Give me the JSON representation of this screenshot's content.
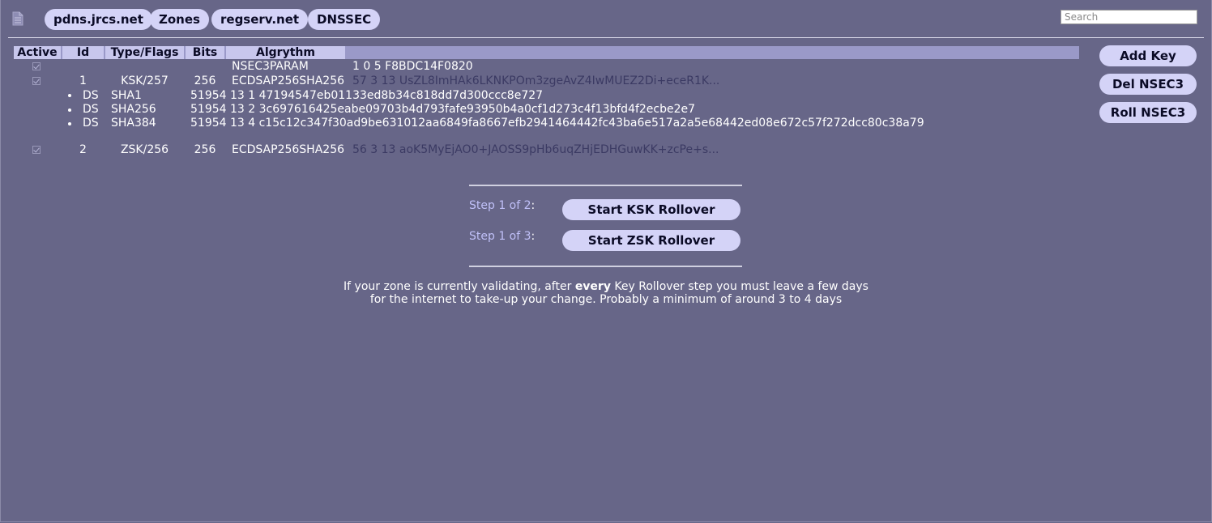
{
  "nav": {
    "items": [
      "pdns.jrcs.net",
      "Zones",
      "regserv.net",
      "DNSSEC"
    ],
    "search_placeholder": "Search"
  },
  "table": {
    "headers": [
      "Active",
      "Id",
      "Type/Flags",
      "Bits",
      "Algrythm"
    ],
    "nsec3param": {
      "label": "NSEC3PARAM",
      "value": "1 0 5 F8BDC14F0820",
      "active": true
    },
    "keys": [
      {
        "active": true,
        "id": "1",
        "type_flags": "KSK/257",
        "bits": "256",
        "algorithm": "ECDSAP256SHA256",
        "key": "57 3 13 UsZL8ImHAk6LKNKPOm3zgeAvZ4IwMUEZ2Di+eceR1K...",
        "ds": [
          {
            "label": "DS",
            "digest_type": "SHA1",
            "value": "51954 13 1 47194547eb01133ed8b34c818dd7d300ccc8e727"
          },
          {
            "label": "DS",
            "digest_type": "SHA256",
            "value": "51954 13 2 3c697616425eabe09703b4d793fafe93950b4a0cf1d273c4f13bfd4f2ecbe2e7"
          },
          {
            "label": "DS",
            "digest_type": "SHA384",
            "value": "51954 13 4 c15c12c347f30ad9be631012aa6849fa8667efb2941464442fc43ba6e517a2a5e68442ed08e672c57f272dcc80c38a79"
          }
        ]
      },
      {
        "active": true,
        "id": "2",
        "type_flags": "ZSK/256",
        "bits": "256",
        "algorithm": "ECDSAP256SHA256",
        "key": "56 3 13 aoK5MyEjAO0+JAOSS9pHb6uqZHjEDHGuwKK+zcPe+s..."
      }
    ]
  },
  "side_buttons": {
    "add_key": "Add Key",
    "del_nsec3": "Del NSEC3",
    "roll_nsec3": "Roll NSEC3"
  },
  "rollover": {
    "ksk": {
      "step_text": "Step 1 of 2",
      "button": "Start KSK Rollover"
    },
    "zsk": {
      "step_text": "Step 1 of 3",
      "button": "Start ZSK Rollover"
    },
    "colon": ":"
  },
  "note": {
    "before": "If your zone is currently validating, after ",
    "emphasis": "every",
    "after": " Key Rollover step you must leave a few days",
    "line2": "for the internet to take-up your change. Probably a minimum of around 3 to 4 days"
  },
  "colors": {
    "background": "#676688",
    "pill": "#d4d3f7",
    "header_bar": "#9a99c8",
    "header_cell": "#c8c7ed",
    "step_text": "#c0c0f8",
    "muted_key": "#3b3a63"
  }
}
